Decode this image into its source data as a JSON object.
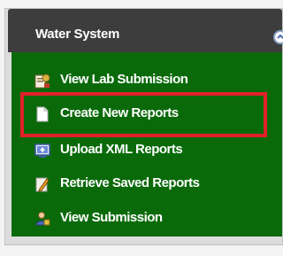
{
  "panel": {
    "title": "Water System"
  },
  "menu": {
    "items": [
      {
        "label": "View Lab Submission",
        "icon": "lab-report-icon"
      },
      {
        "label": "Create New Reports",
        "icon": "document-icon"
      },
      {
        "label": "Upload XML Reports",
        "icon": "upload-screen-icon"
      },
      {
        "label": "Retrieve Saved Reports",
        "icon": "pencil-doc-icon"
      },
      {
        "label": "View Submission",
        "icon": "user-lock-icon"
      }
    ]
  },
  "highlight": {
    "color": "#e0202a",
    "target": "Create New Reports"
  },
  "colors": {
    "header": "#3d3d3d",
    "menu_background": "#0a6a0a",
    "text": "#ffffff"
  }
}
